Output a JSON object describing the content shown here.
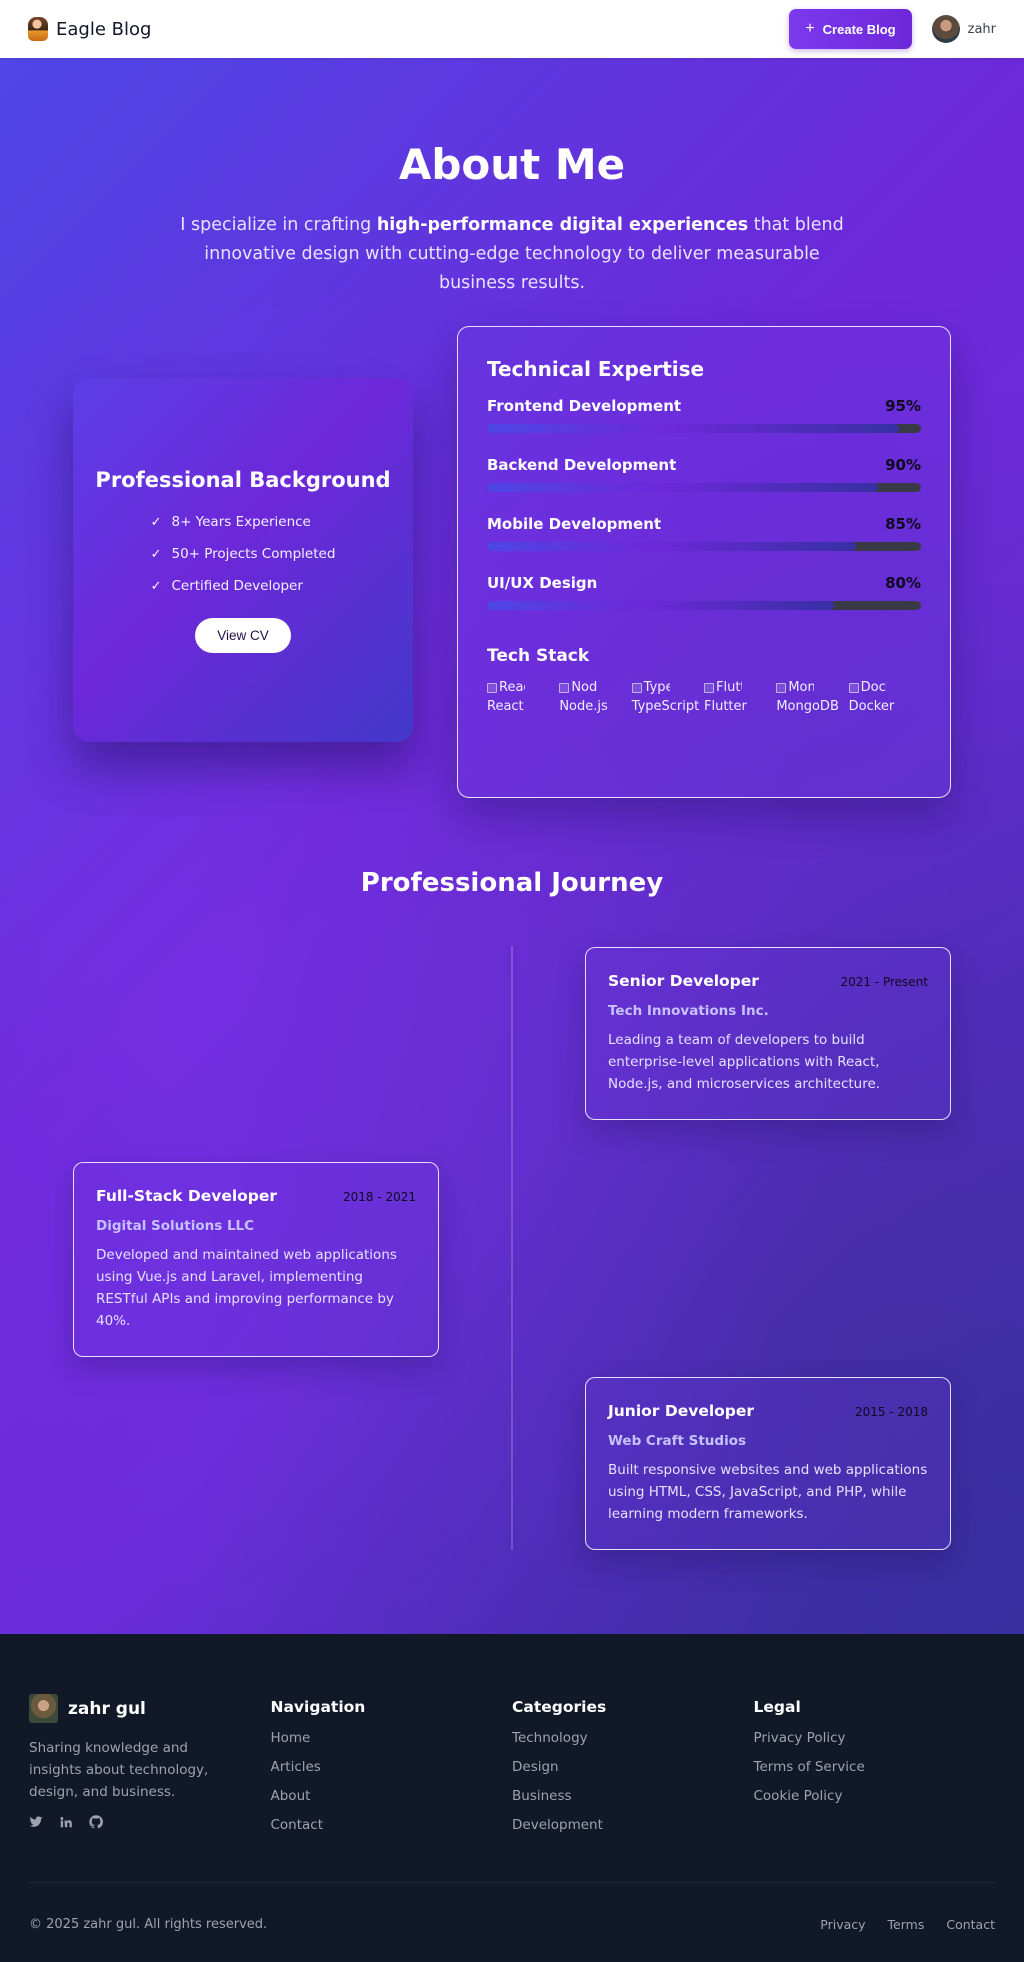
{
  "nav": {
    "brand": "Eagle Blog",
    "create_label": "Create Blog",
    "user_name": "zahr"
  },
  "hero": {
    "title": "About Me",
    "subtitle_pre": "I specialize in crafting ",
    "subtitle_bold": "high-performance digital experiences",
    "subtitle_post": " that blend innovative design with cutting-edge technology to deliver measurable business results."
  },
  "background": {
    "title": "Professional Background",
    "items": [
      "8+ Years Experience",
      "50+ Projects Completed",
      "Certified Developer"
    ],
    "button": "View CV"
  },
  "expertise": {
    "title": "Technical Expertise",
    "skills": [
      {
        "name": "Frontend Development",
        "percent_label": "95%",
        "percent": 95
      },
      {
        "name": "Backend Development",
        "percent_label": "90%",
        "percent": 90
      },
      {
        "name": "Mobile Development",
        "percent_label": "85%",
        "percent": 85
      },
      {
        "name": "UI/UX Design",
        "percent_label": "80%",
        "percent": 80
      }
    ],
    "stack_title": "Tech Stack",
    "stack": [
      {
        "alt": "React",
        "name": "React"
      },
      {
        "alt": "Node",
        "name": "Node.js"
      },
      {
        "alt": "TypeS",
        "name": "TypeScript"
      },
      {
        "alt": "Flutte",
        "name": "Flutter"
      },
      {
        "alt": "Mong",
        "name": "MongoDB"
      },
      {
        "alt": "Docke",
        "name": "Docker"
      }
    ]
  },
  "journey": {
    "title": "Professional Journey",
    "jobs": [
      {
        "title": "Senior Developer",
        "date": "2021 - Present",
        "company": "Tech Innovations Inc.",
        "desc": "Leading a team of developers to build enterprise-level applications with React, Node.js, and microservices architecture."
      },
      {
        "title": "Full-Stack Developer",
        "date": "2018 - 2021",
        "company": "Digital Solutions LLC",
        "desc": "Developed and maintained web applications using Vue.js and Laravel, implementing RESTful APIs and improving performance by 40%."
      },
      {
        "title": "Junior Developer",
        "date": "2015 - 2018",
        "company": "Web Craft Studios",
        "desc": "Built responsive websites and web applications using HTML, CSS, JavaScript, and PHP, while learning modern frameworks."
      }
    ]
  },
  "footer": {
    "brand": "zahr gul",
    "description": "Sharing knowledge and insights about technology, design, and business.",
    "socials": [
      "twitter-icon",
      "linkedin-icon",
      "github-icon"
    ],
    "navigation": {
      "title": "Navigation",
      "links": [
        "Home",
        "Articles",
        "About",
        "Contact"
      ]
    },
    "categories": {
      "title": "Categories",
      "links": [
        "Technology",
        "Design",
        "Business",
        "Development"
      ]
    },
    "legal": {
      "title": "Legal",
      "links": [
        "Privacy Policy",
        "Terms of Service",
        "Cookie Policy"
      ]
    },
    "copyright": "© 2025 zahr gul. All rights reserved.",
    "bottom_links": [
      "Privacy",
      "Terms",
      "Contact"
    ]
  }
}
